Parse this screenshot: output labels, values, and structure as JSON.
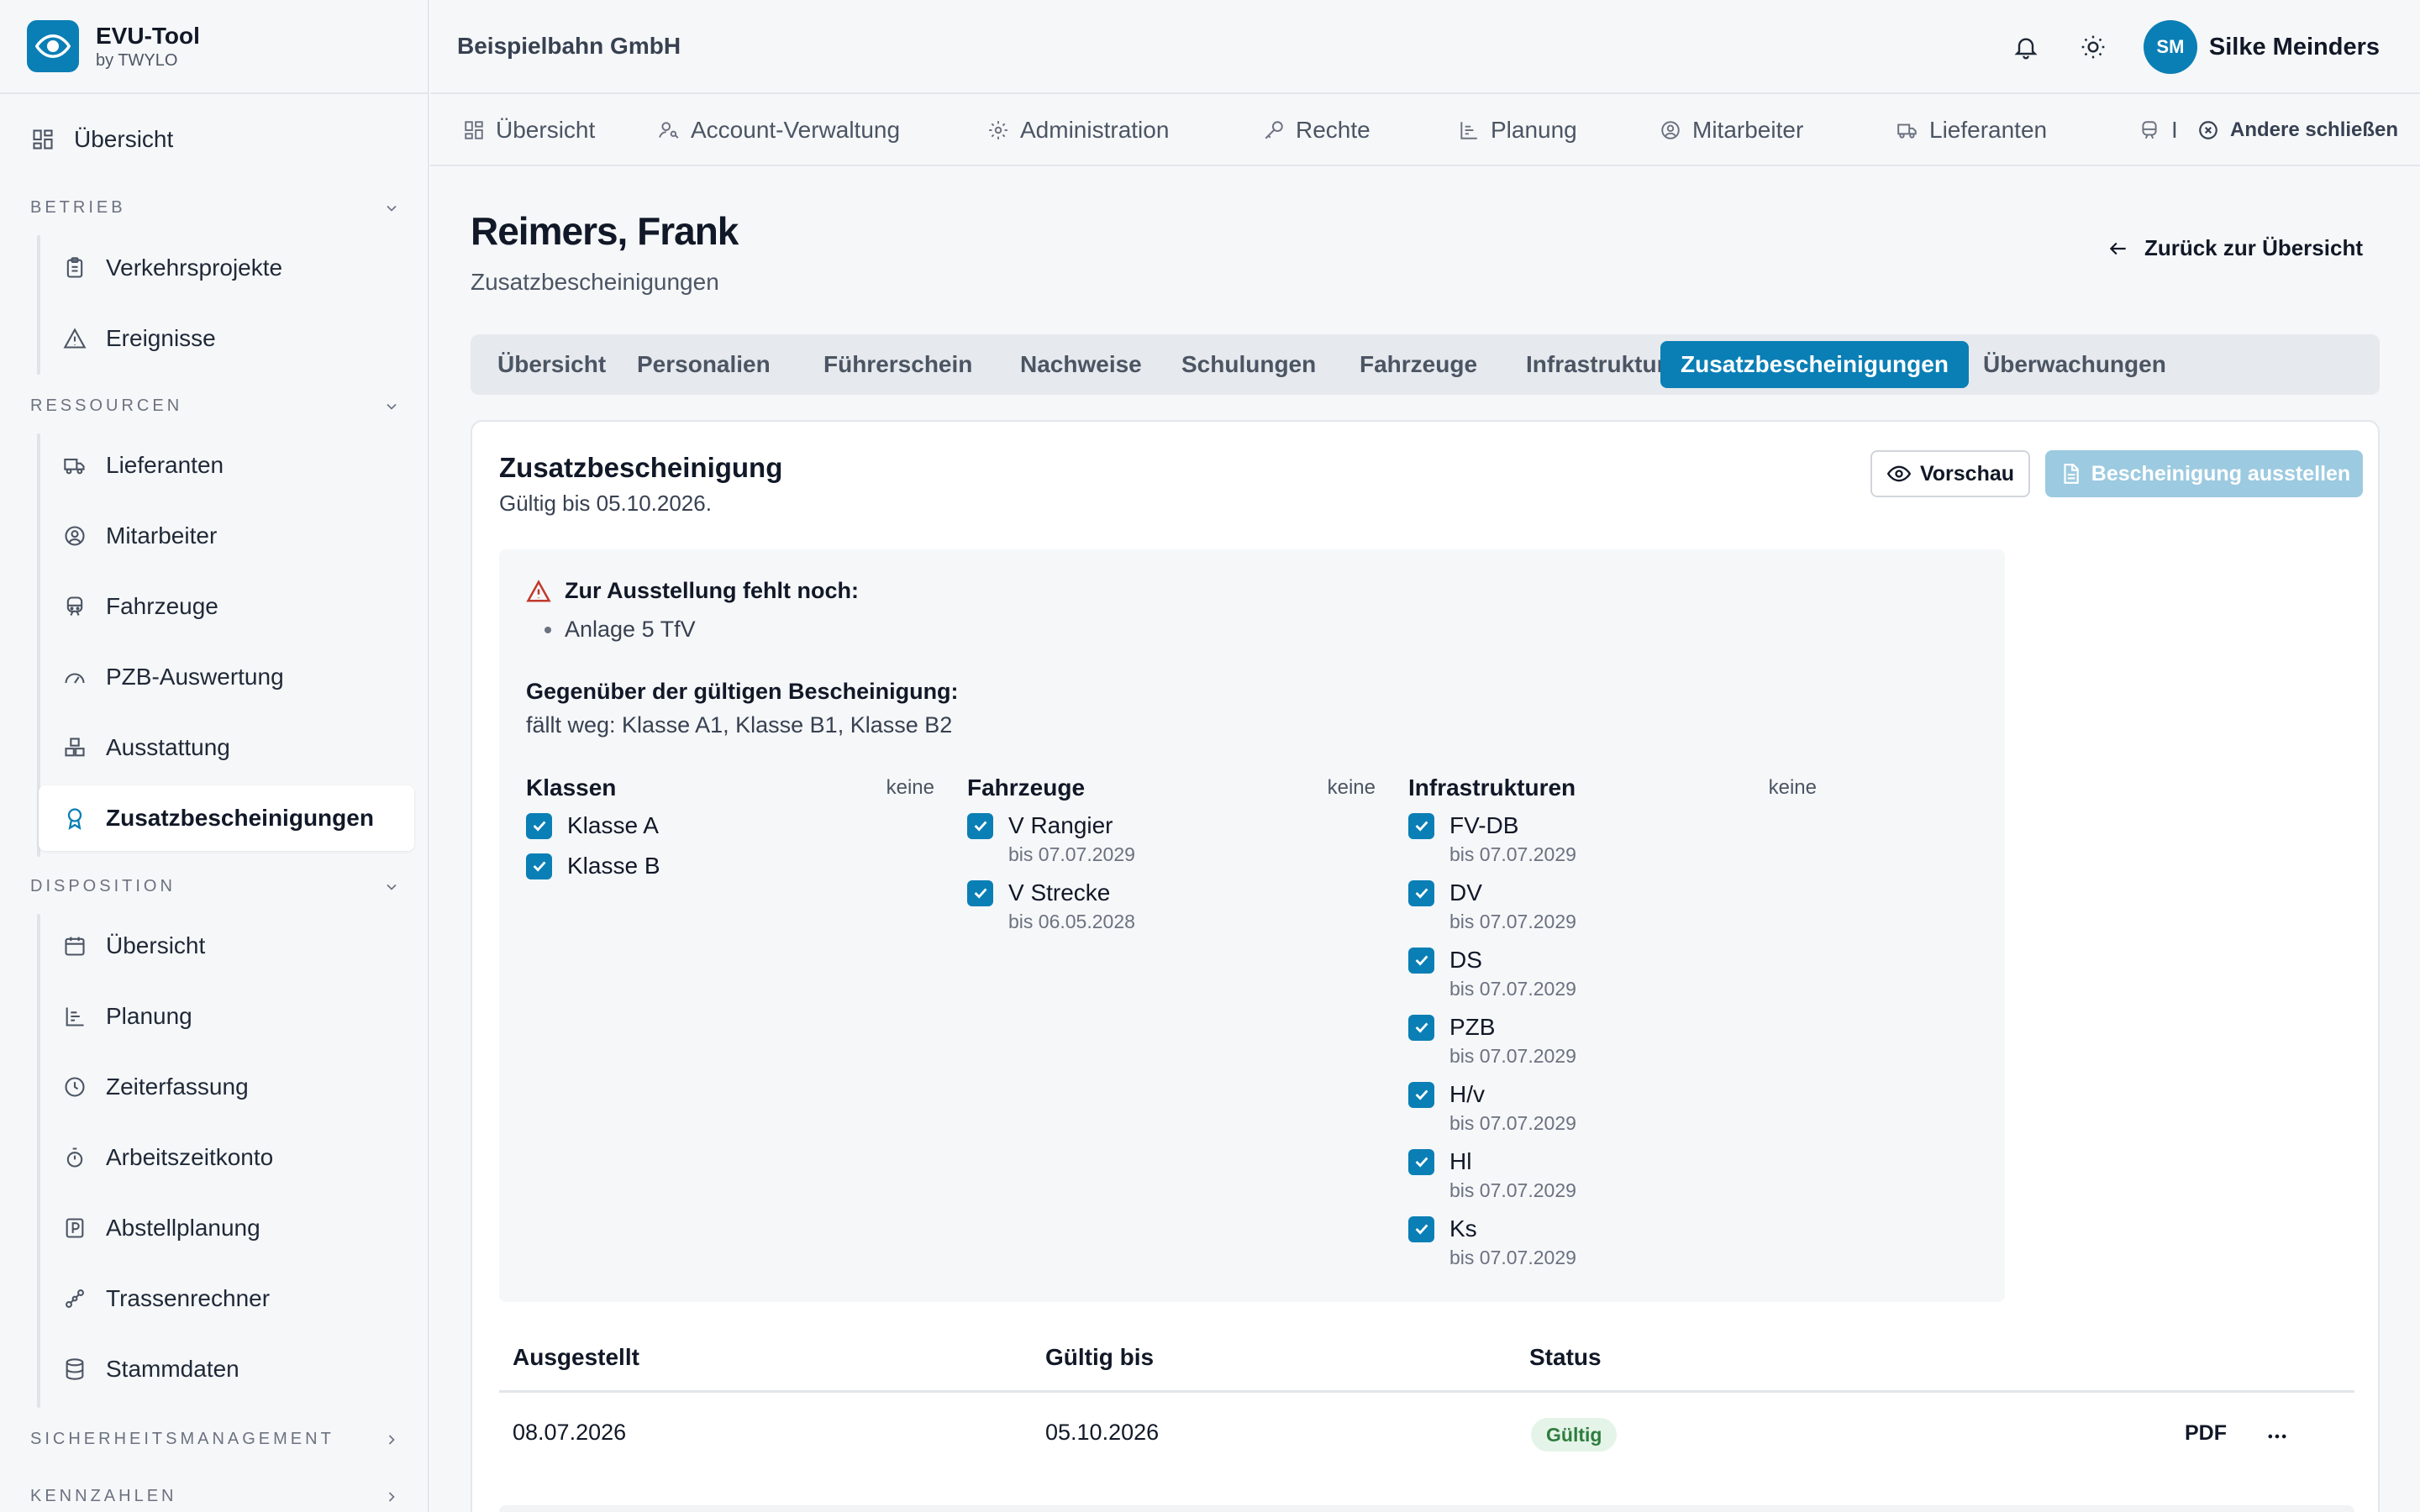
{
  "brand": {
    "name": "EVU-Tool",
    "sub": "by TWYLO"
  },
  "header": {
    "company": "Beispielbahn GmbH",
    "user_initials": "SM",
    "user_name": "Silke Meinders"
  },
  "sidebar": {
    "top": {
      "label": "Übersicht",
      "icon": "grid-icon"
    },
    "sections": [
      {
        "title": "Betrieb",
        "items": [
          {
            "label": "Verkehrsprojekte",
            "icon": "clipboard-icon"
          },
          {
            "label": "Ereignisse",
            "icon": "warning-icon"
          }
        ]
      },
      {
        "title": "Ressourcen",
        "items": [
          {
            "label": "Lieferanten",
            "icon": "truck-icon"
          },
          {
            "label": "Mitarbeiter",
            "icon": "user-circle-icon"
          },
          {
            "label": "Fahrzeuge",
            "icon": "train-icon"
          },
          {
            "label": "PZB-Auswertung",
            "icon": "gauge-icon"
          },
          {
            "label": "Ausstattung",
            "icon": "boxes-icon"
          },
          {
            "label": "Zusatzbescheinigungen",
            "icon": "award-icon"
          }
        ]
      },
      {
        "title": "Disposition",
        "items": [
          {
            "label": "Übersicht",
            "icon": "calendar-icon"
          },
          {
            "label": "Planung",
            "icon": "bar-chart-icon"
          },
          {
            "label": "Zeiterfassung",
            "icon": "clock-icon"
          },
          {
            "label": "Arbeitszeitkonto",
            "icon": "stopwatch-icon"
          },
          {
            "label": "Abstellplanung",
            "icon": "parking-icon"
          },
          {
            "label": "Trassenrechner",
            "icon": "route-icon"
          },
          {
            "label": "Stammdaten",
            "icon": "database-icon"
          }
        ]
      },
      {
        "title": "Sicherheitsmanagement"
      },
      {
        "title": "Kennzahlen"
      }
    ]
  },
  "topnav": {
    "tabs": [
      {
        "label": "Übersicht",
        "icon": "grid-icon"
      },
      {
        "label": "Account-Verwaltung",
        "icon": "user-key-icon"
      },
      {
        "label": "Administration",
        "icon": "gear-icon"
      },
      {
        "label": "Rechte",
        "icon": "key-icon"
      },
      {
        "label": "Planung",
        "icon": "bar-chart-icon"
      },
      {
        "label": "Mitarbeiter",
        "icon": "user-circle-icon"
      },
      {
        "label": "Lieferanten",
        "icon": "truck-icon"
      },
      {
        "label": "I",
        "icon": "train-icon"
      }
    ],
    "close_label": "Andere schließen"
  },
  "page": {
    "person": "Reimers, Frank",
    "subtitle": "Zusatzbescheinigungen",
    "back_label": "Zurück zur Übersicht"
  },
  "subtabs": [
    "Übersicht",
    "Personalien",
    "Führerschein",
    "Nachweise",
    "Schulungen",
    "Fahrzeuge",
    "Infrastrukturen",
    "Zusatzbescheinigungen",
    "Überwachungen"
  ],
  "card": {
    "title": "Zusatzbescheinigung",
    "valid_text": "Gültig bis 05.10.2026.",
    "preview_label": "Vorschau",
    "issue_label": "Bescheinigung ausstellen",
    "missing_title": "Zur Ausstellung fehlt noch:",
    "missing_items": [
      "Anlage 5 TfV"
    ],
    "compare_title": "Gegenüber der gültigen Bescheinigung:",
    "compare_text": "fällt weg: Klasse A1, Klasse B1, Klasse B2",
    "columns": [
      {
        "title": "Klassen",
        "none": "keine",
        "items": [
          {
            "label": "Klasse A"
          },
          {
            "label": "Klasse B"
          }
        ]
      },
      {
        "title": "Fahrzeuge",
        "none": "keine",
        "items": [
          {
            "label": "V Rangier",
            "sub": "bis 07.07.2029"
          },
          {
            "label": "V Strecke",
            "sub": "bis 06.05.2028"
          }
        ]
      },
      {
        "title": "Infrastrukturen",
        "none": "keine",
        "items": [
          {
            "label": "FV-DB",
            "sub": "bis 07.07.2029"
          },
          {
            "label": "DV",
            "sub": "bis 07.07.2029"
          },
          {
            "label": "DS",
            "sub": "bis 07.07.2029"
          },
          {
            "label": "PZB",
            "sub": "bis 07.07.2029"
          },
          {
            "label": "H/v",
            "sub": "bis 07.07.2029"
          },
          {
            "label": "Hl",
            "sub": "bis 07.07.2029"
          },
          {
            "label": "Ks",
            "sub": "bis 07.07.2029"
          }
        ]
      }
    ]
  },
  "table": {
    "headers": [
      "Ausgestellt",
      "Gültig bis",
      "Status"
    ],
    "rows": [
      {
        "issued": "08.07.2026",
        "valid_until": "05.10.2026",
        "status": "Gültig",
        "pdf": "PDF"
      }
    ]
  },
  "colors": {
    "accent": "#0a7fb5",
    "accent_disabled": "#9ccae0",
    "success_bg": "#e4f4e8",
    "success_text": "#2f7d3e",
    "warning": "#c0392b"
  }
}
